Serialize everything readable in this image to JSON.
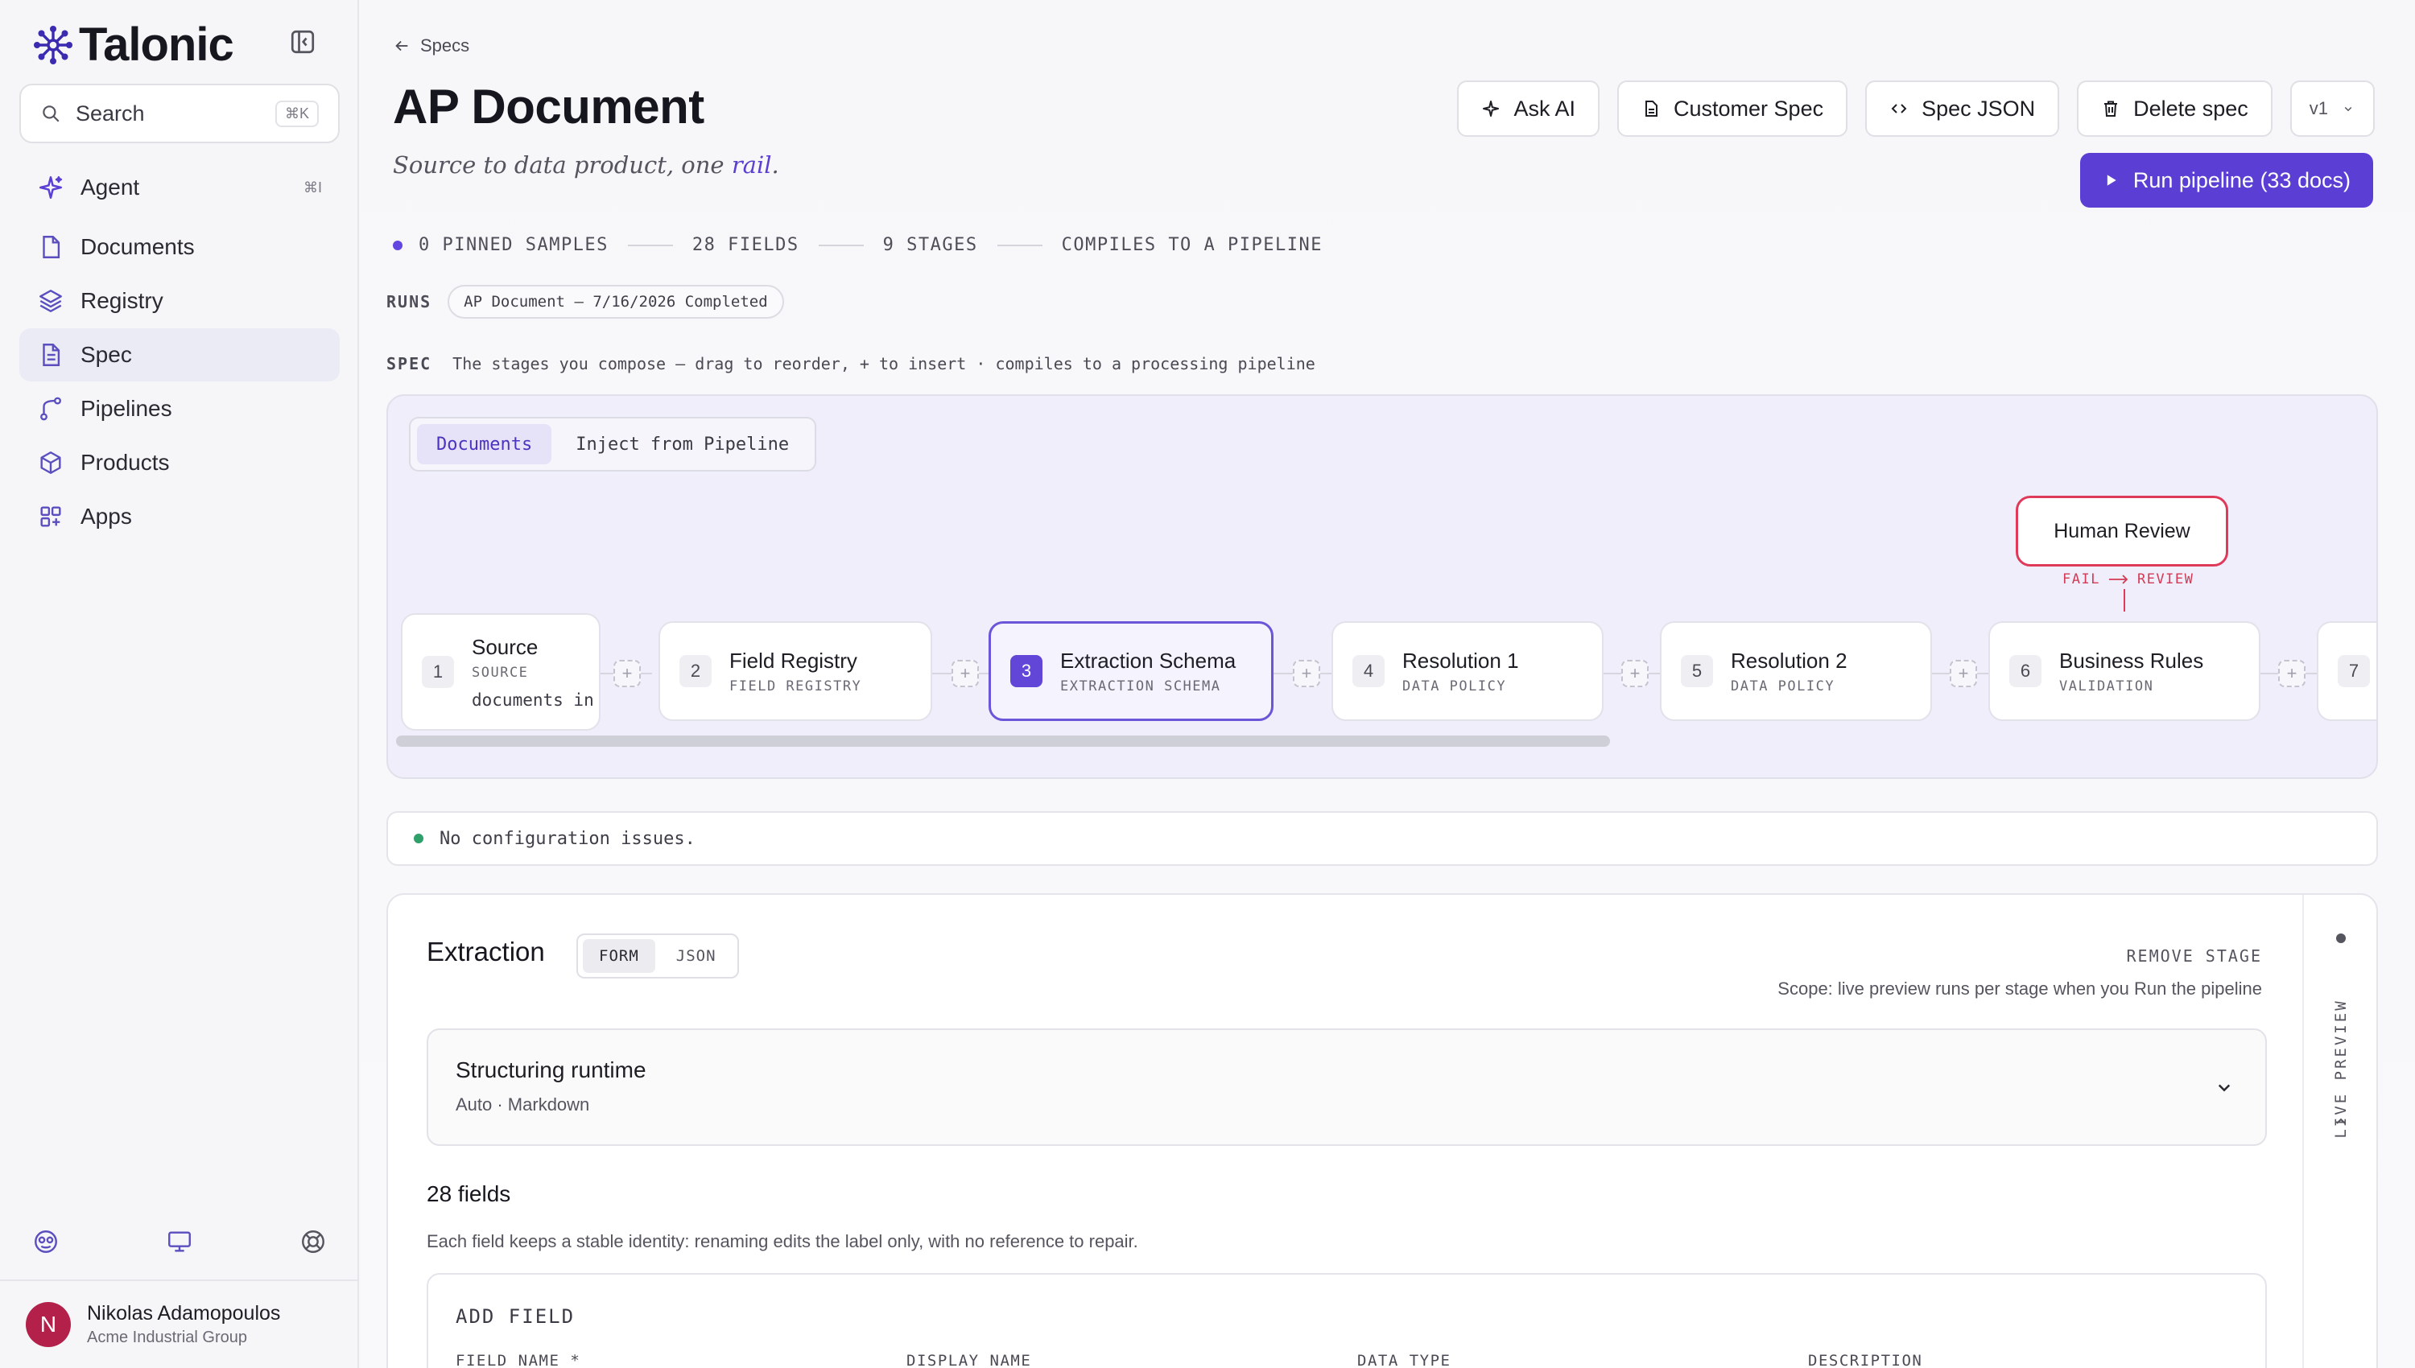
{
  "app": {
    "brand": "Talonic",
    "search_placeholder": "Search",
    "search_shortcut": "⌘K"
  },
  "sidebar": {
    "agent": {
      "label": "Agent",
      "shortcut": "⌘I"
    },
    "items": [
      {
        "label": "Documents",
        "icon": "file-icon"
      },
      {
        "label": "Registry",
        "icon": "layers-icon"
      },
      {
        "label": "Spec",
        "icon": "spec-file-icon",
        "active": true
      },
      {
        "label": "Pipelines",
        "icon": "branch-icon"
      },
      {
        "label": "Products",
        "icon": "cube-icon"
      },
      {
        "label": "Apps",
        "icon": "grid-icon"
      }
    ],
    "footer_icons": [
      "brain-icon",
      "monitor-icon",
      "lifebuoy-icon"
    ],
    "user": {
      "initial": "N",
      "name": "Nikolas Adamopoulos",
      "org": "Acme Industrial Group"
    }
  },
  "header": {
    "back_label": "Specs",
    "title": "AP Document",
    "subtitle_prefix": "Source to data product, one ",
    "subtitle_accent": "rail",
    "subtitle_suffix": ".",
    "buttons": {
      "ask_ai": "Ask AI",
      "customer_spec": "Customer Spec",
      "spec_json": "Spec JSON",
      "delete_spec": "Delete spec",
      "version": "v1"
    },
    "run_button": "Run pipeline (33 docs)"
  },
  "stats": [
    "0 PINNED SAMPLES",
    "28 FIELDS",
    "9 STAGES",
    "COMPILES TO A PIPELINE"
  ],
  "runs": {
    "label": "RUNS",
    "chip": "AP Document — 7/16/2026 Completed"
  },
  "spec": {
    "label": "SPEC",
    "description": "The stages you compose — drag to reorder, + to insert · compiles to a processing pipeline"
  },
  "canvas": {
    "tabs": [
      {
        "label": "Documents",
        "active": true
      },
      {
        "label": "Inject from Pipeline",
        "active": false
      }
    ],
    "human_review": "Human Review",
    "fail_label": "FAIL",
    "review_label": "REVIEW",
    "stages": [
      {
        "num": "1",
        "title": "Source",
        "sub": "SOURCE",
        "extra": "documents in"
      },
      {
        "num": "2",
        "title": "Field Registry",
        "sub": "FIELD REGISTRY"
      },
      {
        "num": "3",
        "title": "Extraction Schema",
        "sub": "EXTRACTION SCHEMA",
        "selected": true
      },
      {
        "num": "4",
        "title": "Resolution 1",
        "sub": "DATA POLICY"
      },
      {
        "num": "5",
        "title": "Resolution 2",
        "sub": "DATA POLICY"
      },
      {
        "num": "6",
        "title": "Business Rules",
        "sub": "VALIDATION"
      },
      {
        "num": "7",
        "title": "",
        "sub": ""
      }
    ]
  },
  "issues": "No configuration issues.",
  "panel": {
    "title": "Extraction",
    "modes": [
      "FORM",
      "JSON"
    ],
    "remove": "REMOVE STAGE",
    "scope": "Scope: live preview runs per stage when you Run the pipeline",
    "live_preview": "LIVE PREVIEW",
    "runtime_title": "Structuring runtime",
    "runtime_sub": "Auto · Markdown",
    "fields_title": "28 fields",
    "fields_desc": "Each field keeps a stable identity: renaming edits the label only, with no reference to repair.",
    "add_field": "ADD FIELD",
    "columns": [
      "FIELD NAME *",
      "DISPLAY NAME",
      "DATA TYPE",
      "DESCRIPTION"
    ]
  },
  "colors": {
    "accent": "#5b3fd4",
    "review": "#e03a5a",
    "ok": "#2ea16a"
  }
}
